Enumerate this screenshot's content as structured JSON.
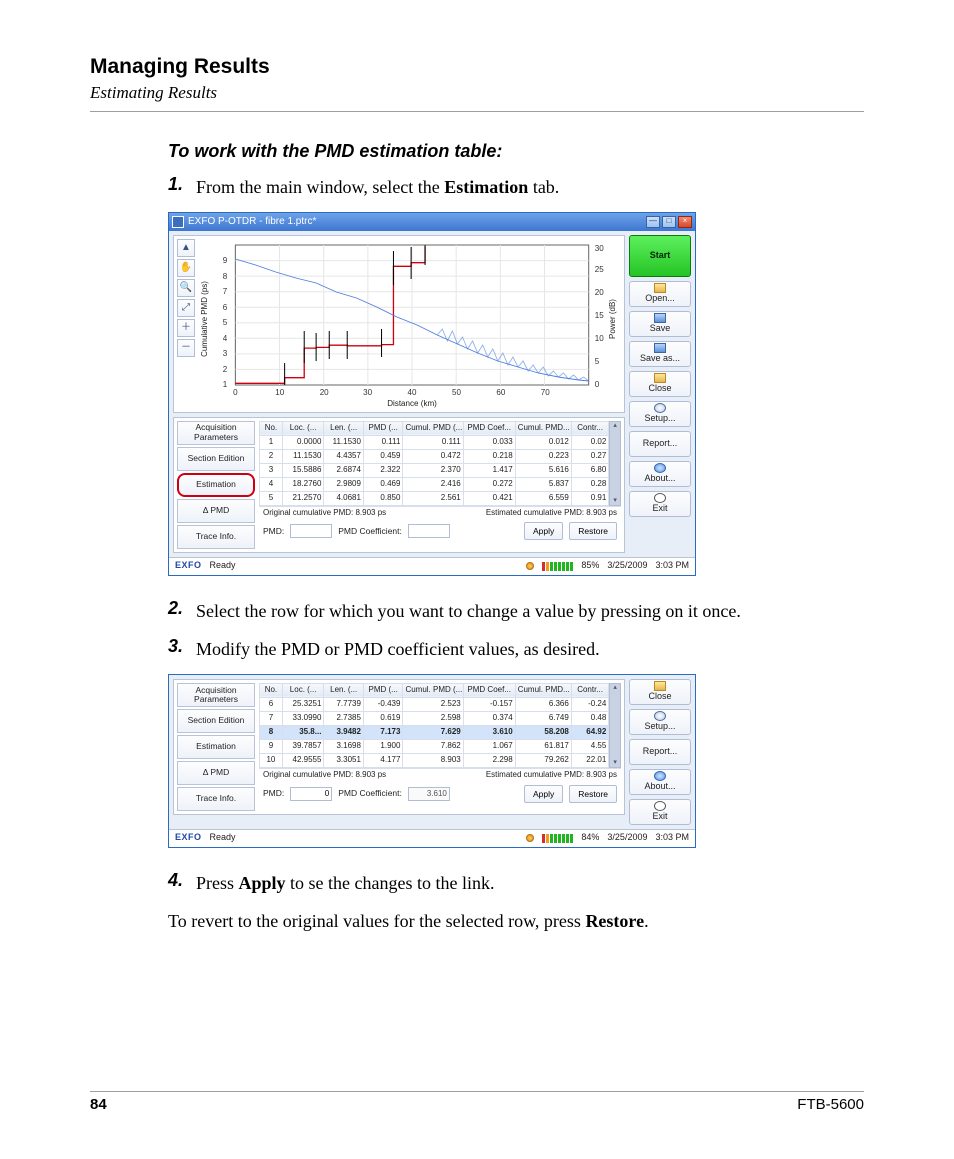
{
  "doc": {
    "chapter": "Managing Results",
    "section": "Estimating Results",
    "task_heading": "To work with the PMD estimation table:",
    "step1_a": "From the main window, select the ",
    "step1_bold": "Estimation",
    "step1_b": " tab.",
    "step2": "Select the row for which you want to change a value by pressing on it once.",
    "step3": "Modify the PMD or PMD coefficient values, as desired.",
    "step4_a": "Press ",
    "step4_bold": "Apply",
    "step4_b": " to se the changes to the link.",
    "after_a": "To revert to the original values for the selected row, press ",
    "after_bold": "Restore",
    "after_b": ".",
    "page_number": "84",
    "product": "FTB-5600"
  },
  "window": {
    "title": "EXFO P-OTDR - fibre 1.ptrc*"
  },
  "buttons": {
    "start": "Start",
    "open": "Open...",
    "save": "Save",
    "saveas": "Save as...",
    "close": "Close",
    "setup": "Setup...",
    "report": "Report...",
    "about": "About...",
    "exit": "Exit"
  },
  "tabs": {
    "acq": "Acquisition Parameters",
    "section": "Section Edition",
    "estimation": "Estimation",
    "dpmd": "Δ PMD",
    "trace": "Trace Info."
  },
  "chart_data": {
    "type": "line",
    "xlabel": "Distance (km)",
    "ylabel_left": "Cumulative PMD (ps)",
    "ylabel_right": "Power (dB)",
    "xlim": [
      0,
      80
    ],
    "ylim_left": [
      0,
      9
    ],
    "ylim_right": [
      0,
      30
    ],
    "x_ticks": [
      0,
      10,
      20,
      30,
      40,
      50,
      60,
      70
    ],
    "y_left_ticks": [
      1,
      2,
      3,
      4,
      5,
      6,
      7,
      8,
      9
    ],
    "y_right_ticks": [
      0,
      5,
      10,
      15,
      20,
      25,
      30
    ],
    "series": [
      {
        "name": "Cumulative PMD",
        "axis": "left",
        "color": "#cc0010",
        "x": [
          0,
          11.15,
          15.59,
          18.28,
          21.26,
          25.33,
          33.1,
          35.8,
          39.79,
          42.96
        ],
        "y": [
          0.111,
          0.472,
          2.37,
          2.416,
          2.561,
          2.523,
          2.598,
          7.629,
          7.862,
          8.903
        ]
      },
      {
        "name": "Power",
        "axis": "right",
        "color": "#4d7de0",
        "x": [
          0,
          10,
          20,
          30,
          40,
          50,
          60,
          70,
          80
        ],
        "y": [
          27,
          24,
          21,
          19,
          15,
          10,
          7,
          4,
          2
        ]
      }
    ],
    "event_marks_x": [
      11.15,
      15.59,
      18.28,
      21.26,
      25.33,
      33.1,
      35.8,
      39.79,
      42.96
    ]
  },
  "table": {
    "headers": [
      "No.",
      "Loc. (...",
      "Len. (...",
      "PMD (...",
      "Cumul. PMD (...",
      "PMD Coef...",
      "Cumul. PMD...",
      "Contr..."
    ],
    "col_widths": [
      "22px",
      "40px",
      "38px",
      "38px",
      "58px",
      "50px",
      "54px",
      "36px"
    ]
  },
  "table1": {
    "rows": [
      [
        "1",
        "0.0000",
        "11.1530",
        "0.111",
        "0.111",
        "0.033",
        "0.012",
        "0.02"
      ],
      [
        "2",
        "11.1530",
        "4.4357",
        "0.459",
        "0.472",
        "0.218",
        "0.223",
        "0.27"
      ],
      [
        "3",
        "15.5886",
        "2.6874",
        "2.322",
        "2.370",
        "1.417",
        "5.616",
        "6.80"
      ],
      [
        "4",
        "18.2760",
        "2.9809",
        "0.469",
        "2.416",
        "0.272",
        "5.837",
        "0.28"
      ],
      [
        "5",
        "21.2570",
        "4.0681",
        "0.850",
        "2.561",
        "0.421",
        "6.559",
        "0.91"
      ]
    ]
  },
  "table2": {
    "selected_index": 2,
    "rows": [
      [
        "6",
        "25.3251",
        "7.7739",
        "-0.439",
        "2.523",
        "-0.157",
        "6.366",
        "-0.24"
      ],
      [
        "7",
        "33.0990",
        "2.7385",
        "0.619",
        "2.598",
        "0.374",
        "6.749",
        "0.48"
      ],
      [
        "8",
        "35.8...",
        "3.9482",
        "7.173",
        "7.629",
        "3.610",
        "58.208",
        "64.92"
      ],
      [
        "9",
        "39.7857",
        "3.1698",
        "1.900",
        "7.862",
        "1.067",
        "61.817",
        "4.55"
      ],
      [
        "10",
        "42.9555",
        "3.3051",
        "4.177",
        "8.903",
        "2.298",
        "79.262",
        "22.01"
      ]
    ]
  },
  "cum": {
    "orig": "Original cumulative PMD: 8.903 ps",
    "est": "Estimated cumulative PMD: 8.903 ps"
  },
  "edit": {
    "pmd_label": "PMD:",
    "coef_label": "PMD Coefficient:",
    "apply": "Apply",
    "restore": "Restore"
  },
  "edit2": {
    "pmd_value": "0",
    "coef_value": "3.610"
  },
  "status": {
    "brand": "EXFO",
    "state": "Ready",
    "battery1": "85%",
    "battery2": "84%",
    "date": "3/25/2009",
    "time": "3:03 PM"
  }
}
